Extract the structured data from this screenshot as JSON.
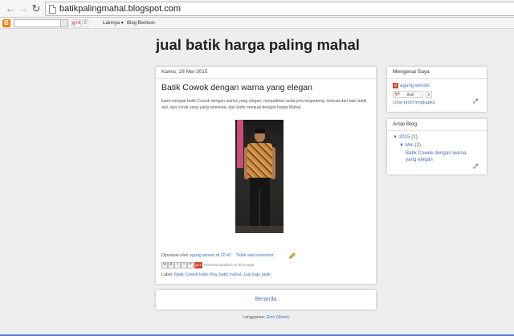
{
  "browser": {
    "url": "batikpalingmahal.blogspot.com",
    "back_icon": "arrow-left-icon",
    "forward_icon": "arrow-right-icon",
    "reload_icon": "reload-icon"
  },
  "navbar": {
    "logo": "B",
    "gplus_label": "g+1",
    "gplus_count": "0",
    "more_label": "Lainnya ▾",
    "next_blog_label": "Blog Berikut»"
  },
  "blog": {
    "title": "jual batik harga paling mahal"
  },
  "post": {
    "date": "Kamis, 28 Mei 2015",
    "title": "Batik Cowok dengan warna yang elegan",
    "body": "kami menjual batik Cowok dengan warna yang elegan, menjadikan anda pria terganteng. terbuat dari kain batik asli, dan corak yang yang istimewa, dan kami menjual dengan harga Mahal.",
    "posted_by": "Diposkan oleh",
    "author": "agung winoto",
    "at_label": "di",
    "time": "20.42",
    "comments": "Tidak ada komentar:",
    "share_buttons": [
      "M",
      "B",
      "t",
      "f",
      "P"
    ],
    "g1_label": "g+1",
    "recommend": "Rekomendasikan ini di Google",
    "labels_prefix": "Label:",
    "labels": [
      "Batik Cowok batik Pria",
      "batik mahal",
      "Jual baju batik"
    ]
  },
  "home_link": "Beranda",
  "subscribe": {
    "prefix": "Langganan:",
    "link": "Entri (Atom)"
  },
  "sidebar": {
    "about": {
      "title": "Mengenai Saya",
      "author": "agung winoto",
      "follow_g": "g+",
      "follow_label": "Ikuti",
      "follow_count": "0",
      "profile_link": "Lihat profil lengkapku"
    },
    "archive": {
      "title": "Arsip Blog",
      "year": "2015",
      "year_count": "(1)",
      "month": "Mei",
      "month_count": "(1)",
      "post": "Batik Cowok dengan warna yang elegan"
    }
  },
  "colors": {
    "link": "#4a6fbd",
    "background": "#eeeeee",
    "gplus": "#d14836",
    "blogger": "#f57d00"
  }
}
